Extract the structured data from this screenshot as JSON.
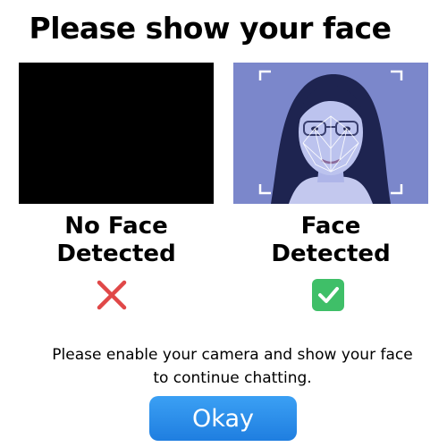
{
  "title": "Please show your face",
  "panels": {
    "left": {
      "status_line1": "No Face",
      "status_line2": "Detected",
      "indicator_icon": "cross-icon",
      "indicator_color": "#e04848"
    },
    "right": {
      "status_line1": "Face",
      "status_line2": "Detected",
      "indicator_icon": "check-icon",
      "indicator_color": "#3fbf68"
    }
  },
  "message": {
    "line1": "Please enable your camera and show your face",
    "line2": "to continue chatting."
  },
  "okay_button": {
    "label": "Okay",
    "color": "#2a8ceb"
  }
}
